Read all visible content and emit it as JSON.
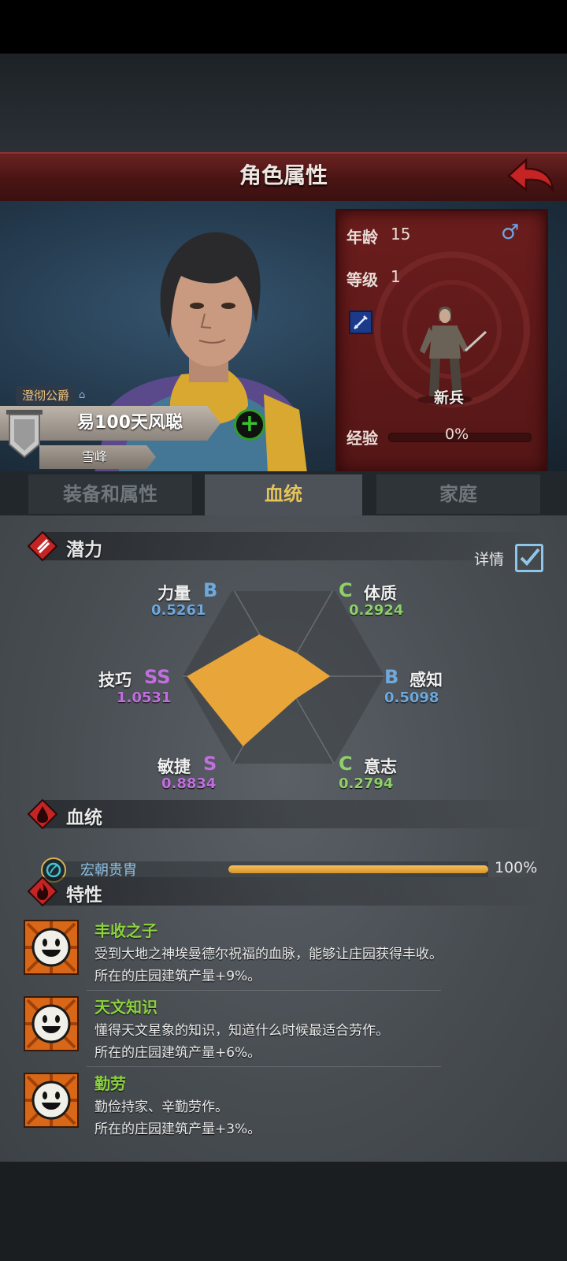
{
  "header": {
    "title": "角色属性"
  },
  "character": {
    "title_rank": "澄彻公爵",
    "name": "易100天风聪",
    "location": "雪峰",
    "age_label": "年龄",
    "age": "15",
    "level_label": "等级",
    "level": "1",
    "gender_symbol": "♂",
    "class_name": "新兵",
    "exp_label": "经验",
    "exp_value": "0%",
    "exp_fraction": 0
  },
  "tabs": [
    {
      "label": "装备和属性"
    },
    {
      "label": "血统"
    },
    {
      "label": "家庭"
    }
  ],
  "active_tab": 1,
  "potential": {
    "title": "潜力",
    "details_label": "详情",
    "details_checked": true,
    "stats": {
      "strength": {
        "name": "力量",
        "grade": "B",
        "value": "0.5261"
      },
      "constitution": {
        "name": "体质",
        "grade": "C",
        "value": "0.2924"
      },
      "perception": {
        "name": "感知",
        "grade": "B",
        "value": "0.5098"
      },
      "will": {
        "name": "意志",
        "grade": "C",
        "value": "0.2794"
      },
      "agility": {
        "name": "敏捷",
        "grade": "S",
        "value": "0.8834"
      },
      "skill": {
        "name": "技巧",
        "grade": "SS",
        "value": "1.0531"
      }
    },
    "radar_values": [
      0.5261,
      0.2924,
      0.5098,
      0.2794,
      0.8834,
      1.0531
    ],
    "colors": {
      "B": "#6ea8dc",
      "C": "#8fd06a",
      "S": "#c36ee0",
      "SS": "#c36ee0",
      "radar_fill": "#e8a53a"
    }
  },
  "lineage": {
    "title": "血统",
    "name": "宏朝贵胄",
    "percent": "100%",
    "fraction": 1.0
  },
  "traits": {
    "title": "特性",
    "items": [
      {
        "name": "丰收之子",
        "desc1": "受到大地之神埃曼德尔祝福的血脉，能够让庄园获得丰收。",
        "desc2": "所在的庄园建筑产量+9%。"
      },
      {
        "name": "天文知识",
        "desc1": "懂得天文星象的知识，知道什么时候最适合劳作。",
        "desc2": "所在的庄园建筑产量+6%。"
      },
      {
        "name": "勤劳",
        "desc1": "勤俭持家、辛勤劳作。",
        "desc2": "所在的庄园建筑产量+3%。"
      }
    ]
  }
}
